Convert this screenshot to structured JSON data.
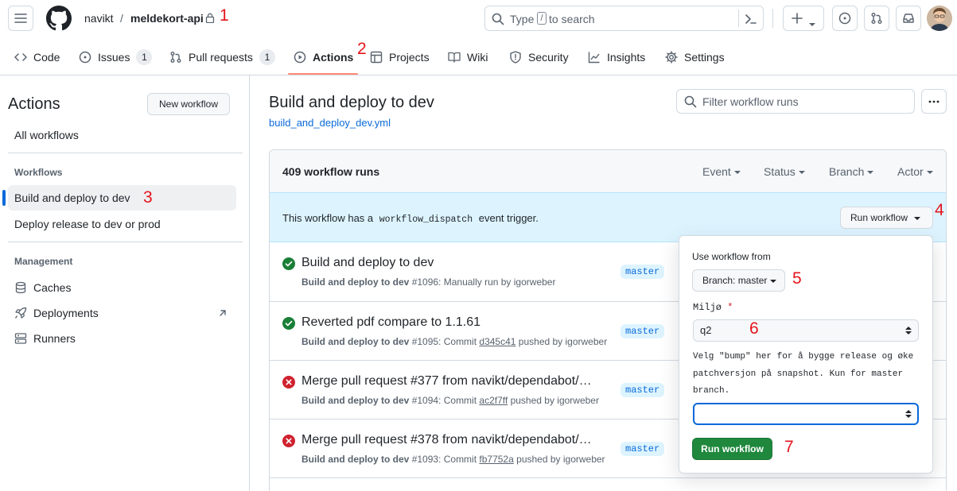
{
  "header": {
    "owner": "navikt",
    "separator": "/",
    "repo": "meldekort-api",
    "search_placeholder_before": "Type",
    "search_key": "/",
    "search_placeholder_after": "to search"
  },
  "tabs": [
    {
      "label": "Code"
    },
    {
      "label": "Issues",
      "count": "1"
    },
    {
      "label": "Pull requests",
      "count": "1"
    },
    {
      "label": "Actions"
    },
    {
      "label": "Projects"
    },
    {
      "label": "Wiki"
    },
    {
      "label": "Security"
    },
    {
      "label": "Insights"
    },
    {
      "label": "Settings"
    }
  ],
  "sidebar": {
    "title": "Actions",
    "new_workflow": "New workflow",
    "all_workflows": "All workflows",
    "workflows_heading": "Workflows",
    "workflows": [
      "Build and deploy to dev",
      "Deploy release to dev or prod"
    ],
    "management_heading": "Management",
    "management": [
      "Caches",
      "Deployments",
      "Runners"
    ]
  },
  "main": {
    "title": "Build and deploy to dev",
    "file": "build_and_deploy_dev.yml",
    "filter_placeholder": "Filter workflow runs",
    "runs_count": "409 workflow runs",
    "filters": [
      "Event",
      "Status",
      "Branch",
      "Actor"
    ],
    "dispatch_pre": "This workflow has a",
    "dispatch_code": "workflow_dispatch",
    "dispatch_post": "event trigger.",
    "run_workflow_button": "Run workflow"
  },
  "runs": [
    {
      "status": "success",
      "title": "Build and deploy to dev",
      "workflow": "Build and deploy to dev",
      "meta_pre": "#1096: Manually run by igorweber",
      "commit": "",
      "meta_post": "",
      "branch": "master"
    },
    {
      "status": "success",
      "title": "Reverted pdf compare to 1.1.61",
      "workflow": "Build and deploy to dev",
      "meta_pre": "#1095: Commit",
      "commit": "d345c41",
      "meta_post": "pushed by igorweber",
      "branch": "master"
    },
    {
      "status": "failure",
      "title": "Merge pull request #377 from navikt/dependabot/…",
      "workflow": "Build and deploy to dev",
      "meta_pre": "#1094: Commit",
      "commit": "ac2f7ff",
      "meta_post": "pushed by igorweber",
      "branch": "master"
    },
    {
      "status": "failure",
      "title": "Merge pull request #378 from navikt/dependabot/…",
      "workflow": "Build and deploy to dev",
      "meta_pre": "#1093: Commit",
      "commit": "fb7752a",
      "meta_post": "pushed by igorweber",
      "branch": "master"
    }
  ],
  "popup": {
    "use_from": "Use workflow from",
    "branch_button": "Branch: master",
    "miljo_label": "Miljø",
    "required_mark": "*",
    "miljo_value": "q2",
    "bump_desc": "Velg \"bump\" her for å bygge release og øke patchversjon på snapshot. Kun for master branch.",
    "bump_value": "",
    "submit": "Run workflow"
  },
  "annotations": [
    "1",
    "2",
    "3",
    "4",
    "5",
    "6",
    "7"
  ],
  "colors": {
    "accent_blue": "#0969da",
    "success": "#1a7f37",
    "failure": "#cf222e",
    "tab_underline": "#fd8c73",
    "annotation_red": "#e5141b",
    "dispatch_bg": "#ddf4ff",
    "primary_button": "#1f883d"
  }
}
